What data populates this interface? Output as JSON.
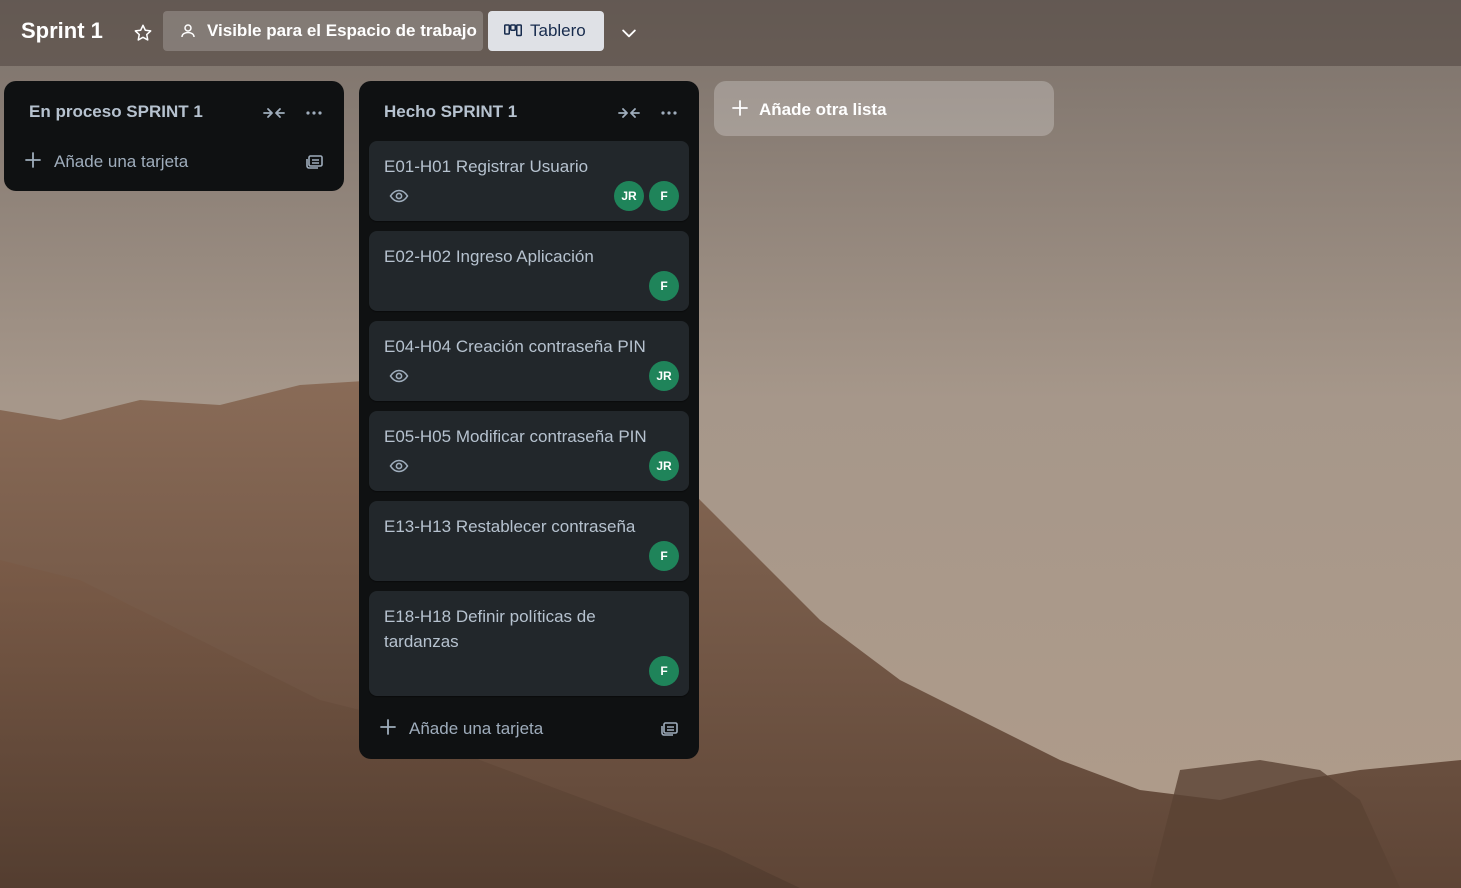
{
  "board": {
    "title": "Sprint 1",
    "visibility_label": "Visible para el Espacio de trabajo",
    "view_label": "Tablero"
  },
  "lists": [
    {
      "title": "En proceso SPRINT 1",
      "add_card_label": "Añade una tarjeta",
      "cards": []
    },
    {
      "title": "Hecho SPRINT 1",
      "add_card_label": "Añade una tarjeta",
      "cards": [
        {
          "title": "E01-H01 Registrar Usuario",
          "watching": true,
          "members": [
            "JR",
            "F"
          ]
        },
        {
          "title": "E02-H02 Ingreso Aplicación",
          "watching": false,
          "members": [
            "F"
          ]
        },
        {
          "title": "E04-H04 Creación contraseña PIN",
          "watching": true,
          "members": [
            "JR"
          ]
        },
        {
          "title": "E05-H05 Modificar contraseña PIN",
          "watching": true,
          "members": [
            "JR"
          ]
        },
        {
          "title": "E13-H13 Restablecer contraseña",
          "watching": false,
          "members": [
            "F"
          ]
        },
        {
          "title": "E18-H18 Definir políticas de tardanzas",
          "watching": false,
          "members": [
            "F"
          ]
        }
      ]
    }
  ],
  "add_list_label": "Añade otra lista",
  "colors": {
    "list_bg": "#0f1112",
    "card_bg": "#22272b",
    "avatar_green": "#1f845a",
    "text": "#b6c2cf"
  },
  "icons": {
    "star": "star-icon",
    "visibility": "people-icon",
    "view": "board-icon",
    "chevron": "chevron-down-icon",
    "collapse": "collapse-icon",
    "menu": "more-icon",
    "watch": "eye-icon",
    "template": "template-icon",
    "plus": "plus-icon"
  }
}
